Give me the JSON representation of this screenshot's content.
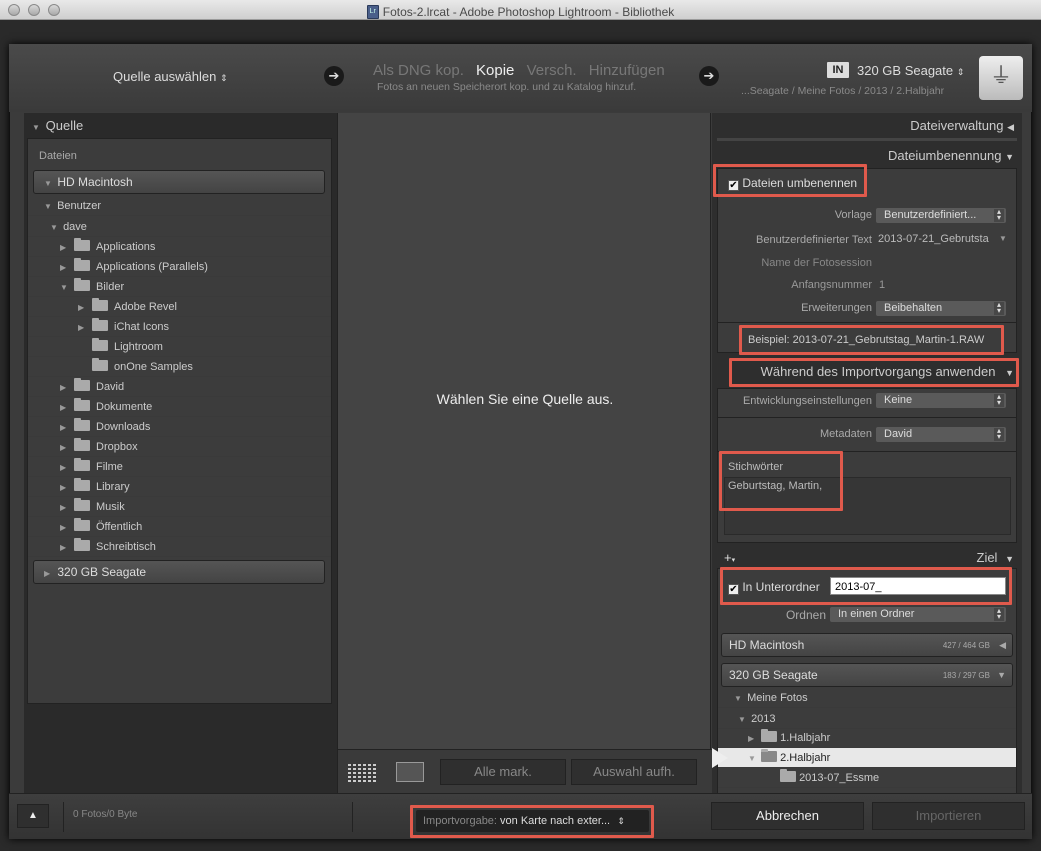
{
  "window": {
    "title": "Fotos-2.lrcat - Adobe Photoshop Lightroom - Bibliothek"
  },
  "topbar": {
    "source_select": "Quelle auswählen",
    "modes": [
      "Als DNG kop.",
      "Kopie",
      "Versch.",
      "Hinzufügen"
    ],
    "active_mode": "Kopie",
    "mode_description": "Fotos an neuen Speicherort kop. und zu Katalog hinzuf.",
    "dest_badge": "IN",
    "dest_name": "320 GB Seagate",
    "dest_path": "...Seagate / Meine Fotos / 2013 / 2.Halbjahr"
  },
  "left": {
    "header": "Quelle",
    "files_label": "Dateien",
    "volume1": "HD Macintosh",
    "users": "Benutzer",
    "user": "dave",
    "items": [
      {
        "label": "Applications",
        "indent": 0,
        "expanded": false
      },
      {
        "label": "Applications (Parallels)",
        "indent": 0,
        "expanded": false
      },
      {
        "label": "Bilder",
        "indent": 0,
        "expanded": true
      },
      {
        "label": "Adobe Revel",
        "indent": 1,
        "expanded": false
      },
      {
        "label": "iChat Icons",
        "indent": 1,
        "expanded": false
      },
      {
        "label": "Lightroom",
        "indent": 1,
        "expanded": null
      },
      {
        "label": "onOne Samples",
        "indent": 1,
        "expanded": null
      },
      {
        "label": "David",
        "indent": 0,
        "expanded": false
      },
      {
        "label": "Dokumente",
        "indent": 0,
        "expanded": false
      },
      {
        "label": "Downloads",
        "indent": 0,
        "expanded": false
      },
      {
        "label": "Dropbox",
        "indent": 0,
        "expanded": false
      },
      {
        "label": "Filme",
        "indent": 0,
        "expanded": false
      },
      {
        "label": "Library",
        "indent": 0,
        "expanded": false
      },
      {
        "label": "Musik",
        "indent": 0,
        "expanded": false
      },
      {
        "label": "Öffentlich",
        "indent": 0,
        "expanded": false
      },
      {
        "label": "Schreibtisch",
        "indent": 0,
        "expanded": false
      }
    ],
    "volume2": "320 GB Seagate"
  },
  "center": {
    "empty_message": "Wählen Sie eine Quelle aus.",
    "check_all": "Alle mark.",
    "uncheck_all": "Auswahl aufh."
  },
  "right": {
    "file_handling": "Dateiverwaltung",
    "file_rename": "Dateiumbenennung",
    "rename_checkbox": "Dateien umbenennen",
    "template_label": "Vorlage",
    "template_value": "Benutzerdefiniert...",
    "custom_text_label": "Benutzerdefinierter Text",
    "custom_text_value": "2013-07-21_Gebrutsta",
    "session_label": "Name der Fotosession",
    "start_num_label": "Anfangsnummer",
    "start_num_value": "1",
    "extensions_label": "Erweiterungen",
    "extensions_value": "Beibehalten",
    "example_label": "Beispiel:",
    "example_value": "2013-07-21_Gebrutstag_Martin-1.RAW",
    "apply_header": "Während des Importvorgangs anwenden",
    "dev_label": "Entwicklungseinstellungen",
    "dev_value": "Keine",
    "meta_label": "Metadaten",
    "meta_value": "David",
    "keywords_label": "Stichwörter",
    "keywords_value": "Geburtstag, Martin,",
    "dest_header": "Ziel",
    "subfolder_label": "In Unterordner",
    "subfolder_value": "2013-07_",
    "organize_label": "Ordnen",
    "organize_value": "In einen Ordner",
    "vol1": "HD Macintosh",
    "vol1_size": "427 / 464 GB",
    "vol2": "320 GB Seagate",
    "vol2_size": "183 / 297 GB",
    "tree": [
      "Meine Fotos",
      "2013",
      "1.Halbjahr",
      "2.Halbjahr",
      "2013-07_Essme"
    ]
  },
  "bottom": {
    "count": "0 Fotos/0 Byte",
    "preset_label": "Importvorgabe:",
    "preset_value": "von Karte nach exter...",
    "cancel": "Abbrechen",
    "import": "Importieren"
  }
}
